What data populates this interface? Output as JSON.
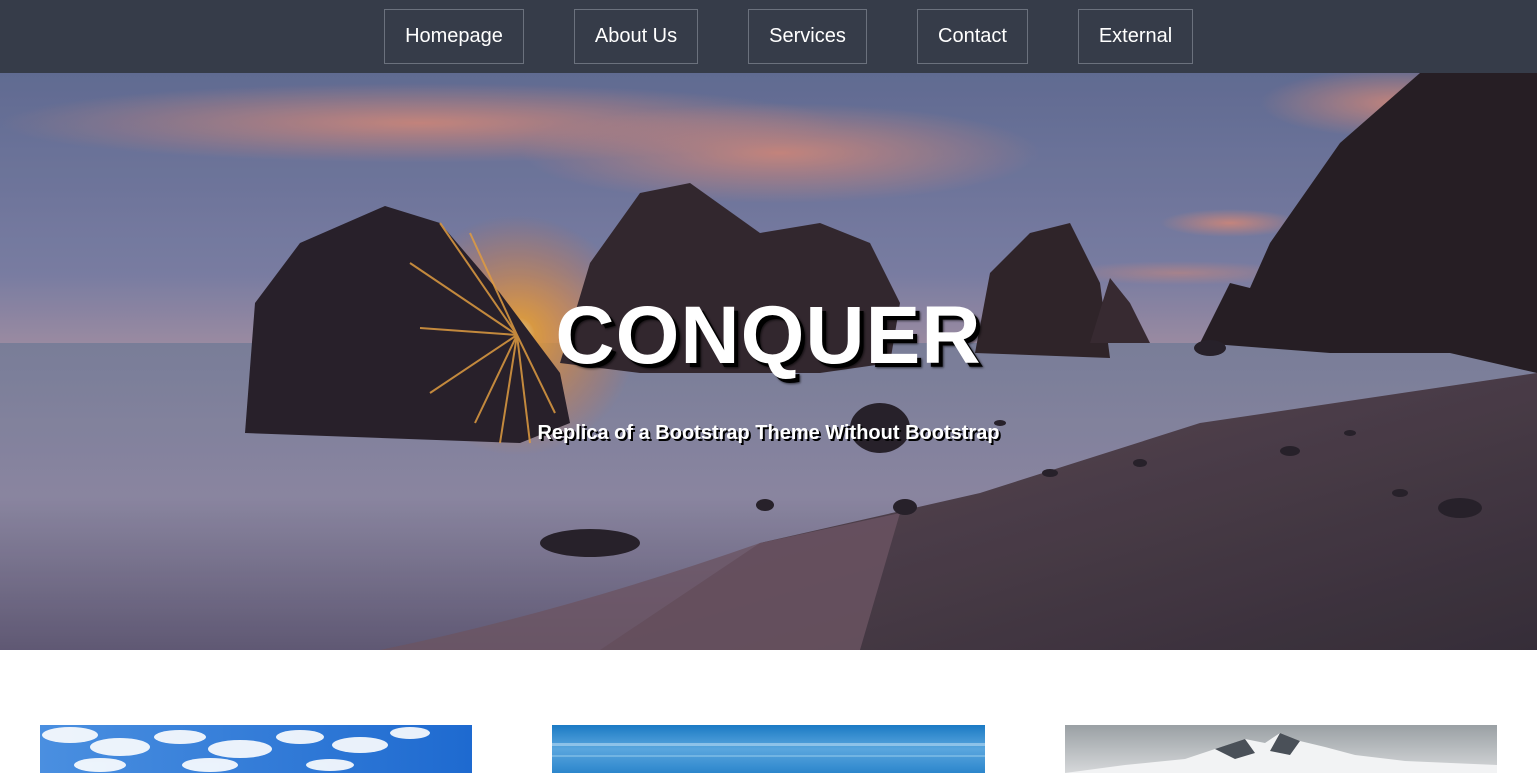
{
  "nav": {
    "items": [
      {
        "label": "Homepage"
      },
      {
        "label": "About Us"
      },
      {
        "label": "Services"
      },
      {
        "label": "Contact"
      },
      {
        "label": "External"
      }
    ]
  },
  "hero": {
    "title": "CONQUER",
    "subtitle": "Replica of a Bootstrap Theme Without Bootstrap",
    "image": "sunset-beach-rocks"
  },
  "cards": [
    {
      "image": "sky-clouds"
    },
    {
      "image": "blue-sea-horizon"
    },
    {
      "image": "snowy-mountains"
    }
  ],
  "colors": {
    "navbar": "#363c49",
    "nav_border": "#6b717d",
    "text": "#ffffff"
  }
}
